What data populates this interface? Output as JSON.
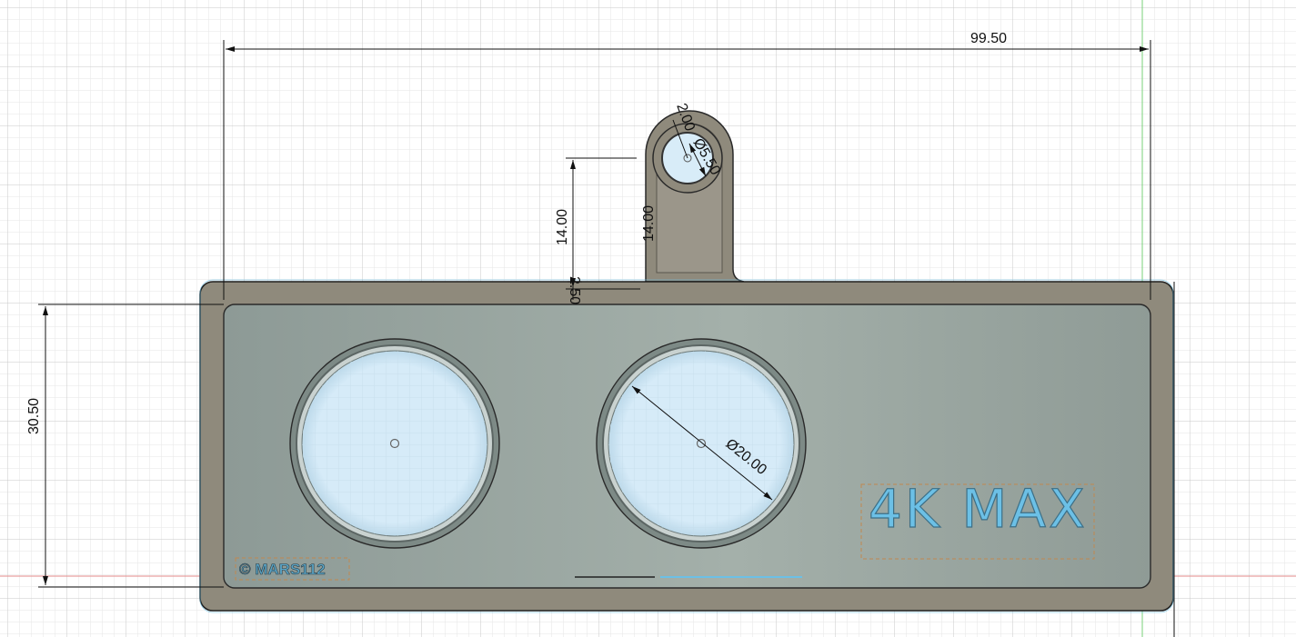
{
  "dimensions": {
    "overall_width": "99.50",
    "lug_height_left": "14.00",
    "lug_height_inner": "14.00",
    "lug_offset": "2.50",
    "body_height": "30.50",
    "ring_width": "2.00",
    "hole_diameter": "Ø5.50",
    "lens_diameter": "Ø20.00"
  },
  "labels": {
    "copyright": "© MARS112",
    "model": "4K MAX"
  },
  "colors": {
    "grid_minor": "#e4e4e4",
    "grid_major": "#c8c8c8",
    "body": "#8f8a7c",
    "face": "#9aa8a0",
    "lens": "#d8ecf8",
    "accent": "#6cc0e6",
    "axis_green": "#79d279",
    "axis_red": "#e38a8a"
  }
}
